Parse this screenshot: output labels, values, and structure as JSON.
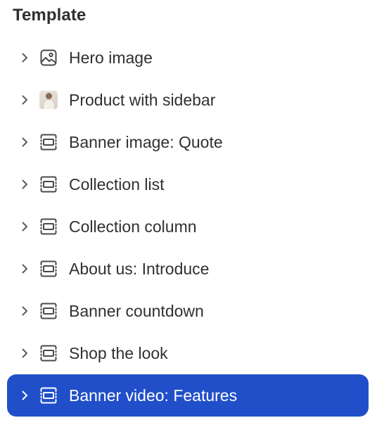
{
  "panel": {
    "title": "Template",
    "items": [
      {
        "label": "Hero image",
        "icon": "image-icon",
        "selected": false
      },
      {
        "label": "Product with sidebar",
        "icon": "product-thumbnail",
        "selected": false
      },
      {
        "label": "Banner image: Quote",
        "icon": "section-icon",
        "selected": false
      },
      {
        "label": "Collection list",
        "icon": "section-icon",
        "selected": false
      },
      {
        "label": "Collection column",
        "icon": "section-icon",
        "selected": false
      },
      {
        "label": "About us: Introduce",
        "icon": "section-icon",
        "selected": false
      },
      {
        "label": "Banner countdown",
        "icon": "section-icon",
        "selected": false
      },
      {
        "label": "Shop the look",
        "icon": "section-icon",
        "selected": false
      },
      {
        "label": "Banner video: Features",
        "icon": "section-icon",
        "selected": true
      }
    ]
  },
  "colors": {
    "selected_background": "#214fc9",
    "text": "#303030",
    "icon": "#4a4a4a"
  }
}
